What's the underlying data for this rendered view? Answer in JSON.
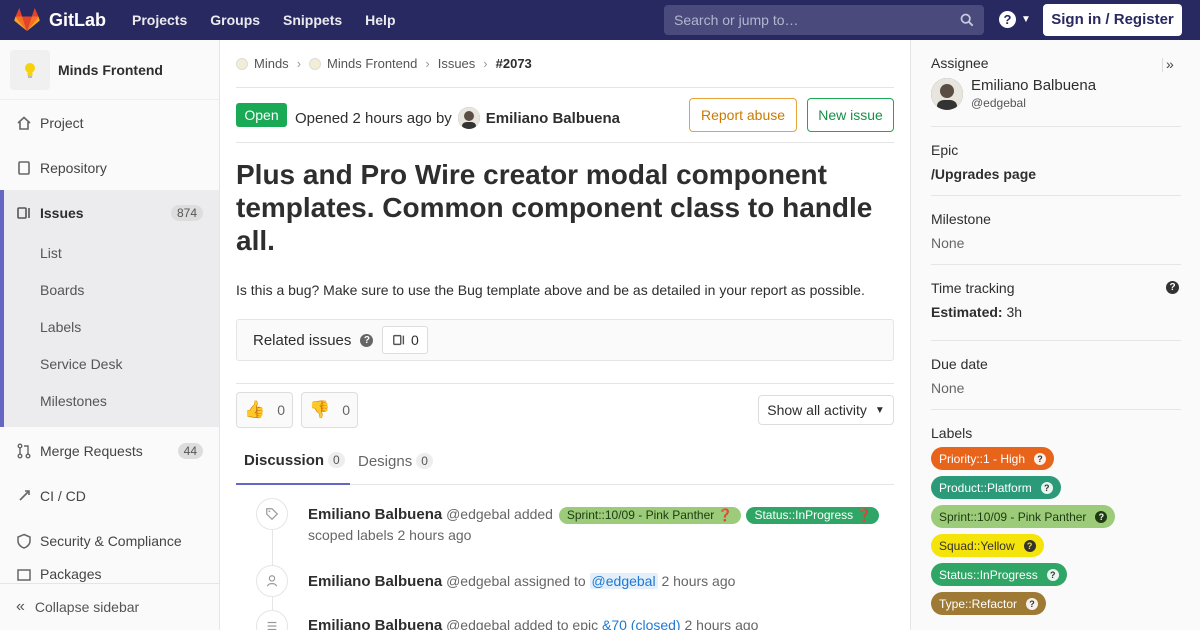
{
  "colors": {
    "nav_bg": "#292961",
    "accent": "#6666c4",
    "open_green": "#1aaa55",
    "report_orange": "#e8a23a"
  },
  "topnav": {
    "brand": "GitLab",
    "links": [
      "Projects",
      "Groups",
      "Snippets",
      "Help"
    ],
    "search_placeholder": "Search or jump to…",
    "help_icon": "question-circle-icon",
    "signin": "Sign in / Register"
  },
  "sidebar": {
    "project_name": "Minds Frontend",
    "items": {
      "project": "Project",
      "repository": "Repository",
      "issues": "Issues",
      "issues_count": "874",
      "merge_requests": "Merge Requests",
      "merge_requests_count": "44",
      "ci_cd": "CI / CD",
      "security": "Security & Compliance",
      "packages": "Packages"
    },
    "issues_sub": [
      "List",
      "Boards",
      "Labels",
      "Service Desk",
      "Milestones"
    ],
    "collapse": "Collapse sidebar"
  },
  "breadcrumb": {
    "group": "Minds",
    "project": "Minds Frontend",
    "section": "Issues",
    "issue": "#2073"
  },
  "issue": {
    "status": "Open",
    "opened_prefix": "Opened 2 hours ago by",
    "author": "Emiliano Balbuena",
    "report_abuse": "Report abuse",
    "new_issue": "New issue",
    "title": "Plus and Pro Wire creator modal component templates. Common component class to handle all.",
    "description": "Is this a bug? Make sure to use the Bug template above and be as detailed in your report as possible.",
    "related_title": "Related issues",
    "related_count": "0",
    "thumbs_up": "0",
    "thumbs_down": "0",
    "show_activity": "Show all activity"
  },
  "tabs": {
    "discussion": "Discussion",
    "discussion_count": "0",
    "designs": "Designs",
    "designs_count": "0"
  },
  "activity": {
    "n1_name": "Emiliano Balbuena",
    "n1_user": "@edgebal",
    "n1_action": "added",
    "n1_label1": "Sprint::10/09 - Pink Panther",
    "n1_label2": "Status::InProgress",
    "n1_tail": "scoped labels 2 hours ago",
    "n2_name": "Emiliano Balbuena",
    "n2_user": "@edgebal",
    "n2_action": "assigned to",
    "n2_mention": "@edgebal",
    "n2_time": "2 hours ago",
    "n3_name": "Emiliano Balbuena",
    "n3_user": "@edgebal",
    "n3_action": "added to epic",
    "n3_link": "&70 (closed)",
    "n3_time": "2 hours ago"
  },
  "right_sidebar": {
    "assignee_title": "Assignee",
    "assignee_name": "Emiliano Balbuena",
    "assignee_user": "@edgebal",
    "epic_title": "Epic",
    "epic_value": "/Upgrades page",
    "milestone_title": "Milestone",
    "milestone_value": "None",
    "time_title": "Time tracking",
    "estimated_label": "Estimated:",
    "estimated_value": "3h",
    "due_title": "Due date",
    "due_value": "None",
    "labels_title": "Labels",
    "labels": [
      {
        "text": "Priority::1 - High",
        "color": "#e8641a"
      },
      {
        "text": "Product::Platform",
        "color": "#2b9a78"
      },
      {
        "text": "Sprint::10/09 - Pink Panther",
        "color": "#9ccc7a"
      },
      {
        "text": "Squad::Yellow",
        "color": "#f5e30c"
      },
      {
        "text": "Status::InProgress",
        "color": "#2fa666"
      },
      {
        "text": "Type::Refactor",
        "color": "#9e7a35"
      }
    ]
  }
}
